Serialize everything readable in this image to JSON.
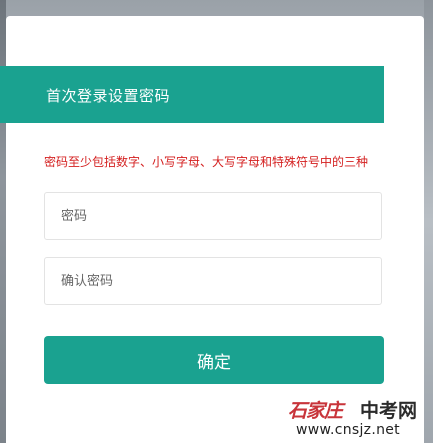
{
  "dialog": {
    "title": "首次登录设置密码",
    "hint": "密码至少包括数字、小写字母、大写字母和特殊符号中的三种",
    "password_placeholder": "密码",
    "confirm_placeholder": "确认密码",
    "submit_label": "确定"
  },
  "watermark": {
    "calligraphy": "石家庄",
    "brand": "中考网",
    "url": "www.cnsjz.net"
  },
  "colors": {
    "accent": "#1aa290",
    "hint": "#d42020"
  }
}
